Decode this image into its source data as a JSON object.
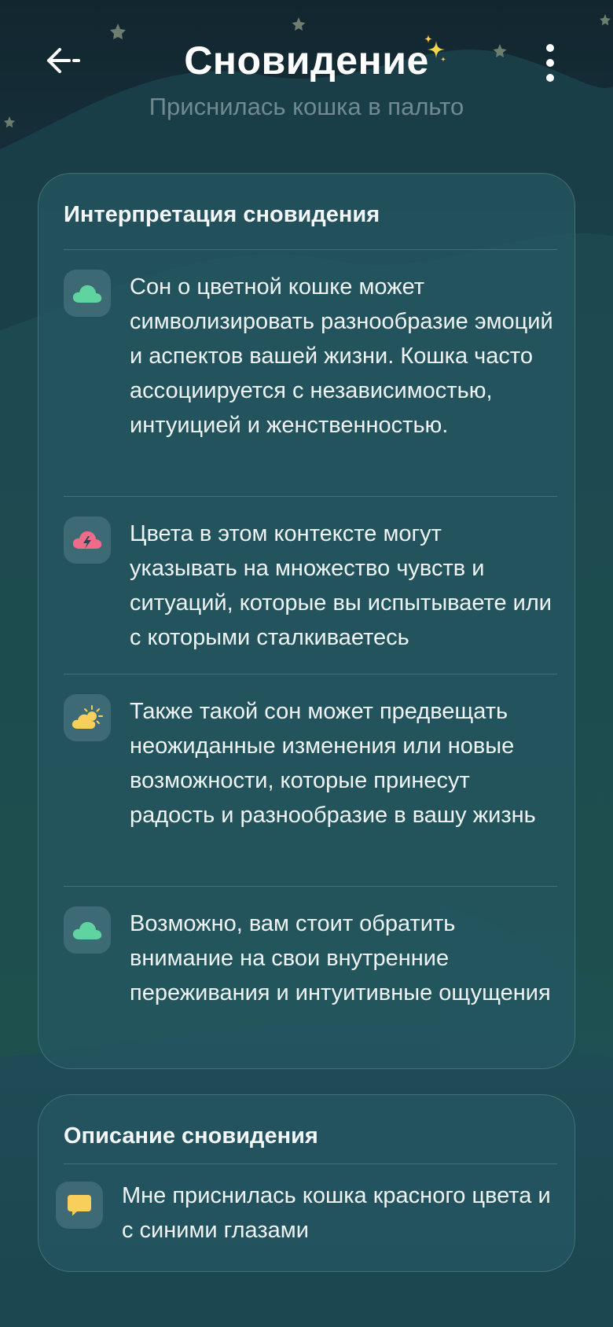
{
  "header": {
    "title": "Сновидение",
    "subtitle": "Приснилась кошка в пальто"
  },
  "interpretation": {
    "title": "Интерпретация сновидения",
    "items": [
      {
        "icon": "green-cloud-icon",
        "color": "#5fd3a0",
        "text": "Сон о цветной кошке может символизировать разнообразие эмоций и аспектов вашей жизни. Кошка часто ассоциируется с независимостью, интуицией и женственностью."
      },
      {
        "icon": "storm-cloud-icon",
        "color": "#f06a8a",
        "text": "Цвета в этом контексте могут указывать на множество чувств и ситуаций, которые вы испытываете или с которыми сталкиваетесь"
      },
      {
        "icon": "sun-cloud-icon",
        "color": "#f7cf5a",
        "text": "Также такой сон может предвещать неожиданные изменения или новые возможности, которые принесут радость и разнообразие в вашу жизнь"
      },
      {
        "icon": "green-cloud-icon",
        "color": "#5fd3a0",
        "text": "Возможно, вам стоит обратить внимание на свои внутренние переживания и интуитивные ощущения"
      }
    ]
  },
  "description": {
    "title": "Описание сновидения",
    "icon": "speech-bubble-icon",
    "text": "Мне приснилась кошка красного цвета и с синими глазами"
  },
  "colors": {
    "background": "#1a3a47",
    "card": "#265862",
    "accent_green": "#5fd3a0",
    "accent_pink": "#f06a8a",
    "accent_yellow": "#f7cf5a"
  }
}
